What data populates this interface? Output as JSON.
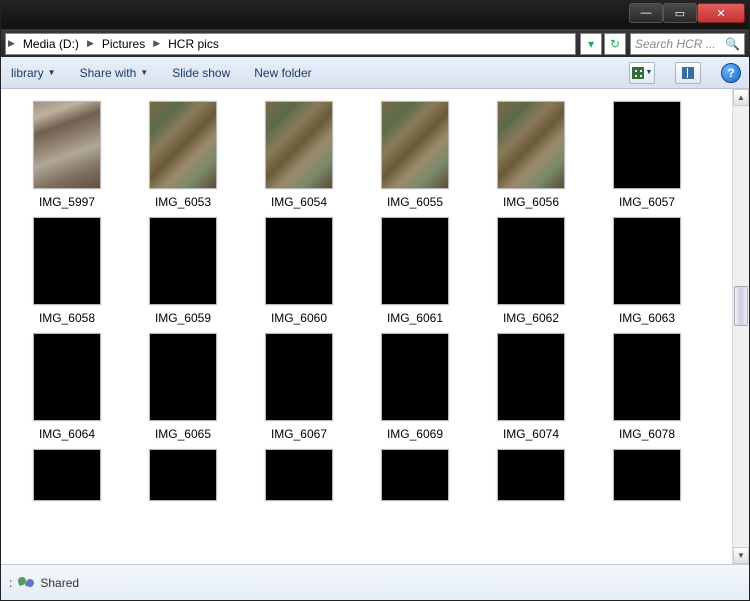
{
  "window": {
    "min_label": "—",
    "max_label": "▭",
    "close_label": "✕"
  },
  "address": {
    "crumbs": [
      "Media (D:)",
      "Pictures",
      "HCR pics"
    ],
    "refresh_glyph": "↻",
    "dropdown_glyph": "▾"
  },
  "search": {
    "placeholder": "Search HCR ..."
  },
  "toolbar": {
    "library_label": "library",
    "share_label": "Share with",
    "slideshow_label": "Slide show",
    "newfolder_label": "New folder"
  },
  "files": [
    {
      "name": "IMG_5997",
      "thumb": "rocklight"
    },
    {
      "name": "IMG_6053",
      "thumb": "rock"
    },
    {
      "name": "IMG_6054",
      "thumb": "rock"
    },
    {
      "name": "IMG_6055",
      "thumb": "rock"
    },
    {
      "name": "IMG_6056",
      "thumb": "rock"
    },
    {
      "name": "IMG_6057",
      "thumb": "black"
    },
    {
      "name": "IMG_6058",
      "thumb": "black"
    },
    {
      "name": "IMG_6059",
      "thumb": "black"
    },
    {
      "name": "IMG_6060",
      "thumb": "black"
    },
    {
      "name": "IMG_6061",
      "thumb": "black"
    },
    {
      "name": "IMG_6062",
      "thumb": "black"
    },
    {
      "name": "IMG_6063",
      "thumb": "black"
    },
    {
      "name": "IMG_6064",
      "thumb": "black"
    },
    {
      "name": "IMG_6065",
      "thumb": "black"
    },
    {
      "name": "IMG_6067",
      "thumb": "black"
    },
    {
      "name": "IMG_6069",
      "thumb": "black"
    },
    {
      "name": "IMG_6074",
      "thumb": "black"
    },
    {
      "name": "IMG_6078",
      "thumb": "black"
    }
  ],
  "partial_files": [
    {
      "name": "",
      "thumb": "black"
    },
    {
      "name": "",
      "thumb": "black"
    },
    {
      "name": "",
      "thumb": "black"
    },
    {
      "name": "",
      "thumb": "black"
    },
    {
      "name": "",
      "thumb": "black"
    },
    {
      "name": "",
      "thumb": "black"
    }
  ],
  "status": {
    "prefix": ":",
    "label": "Shared"
  }
}
